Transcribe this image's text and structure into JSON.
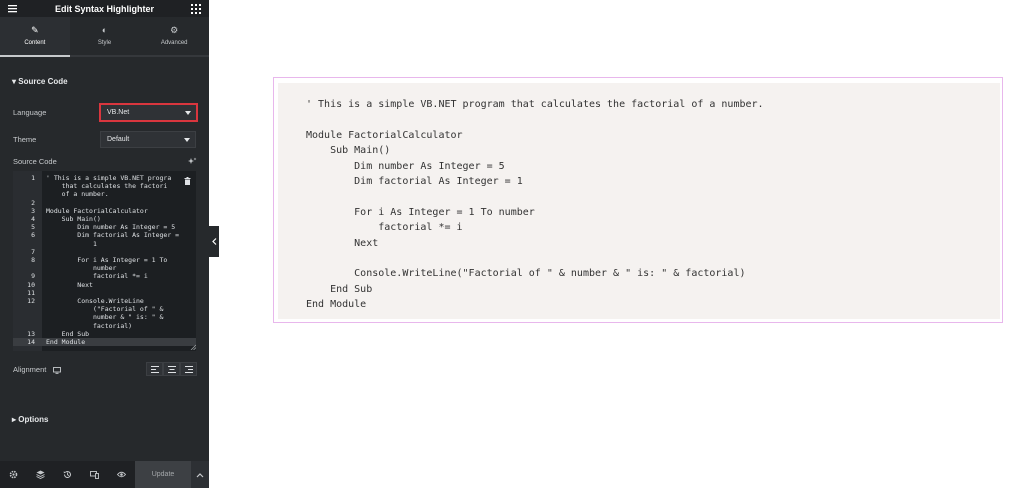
{
  "panel": {
    "title": "Edit Syntax Highlighter",
    "tabs": [
      {
        "label": "Content",
        "icon": "pencil-icon",
        "active": true
      },
      {
        "label": "Style",
        "icon": "half-circle-icon",
        "active": false
      },
      {
        "label": "Advanced",
        "icon": "gear-icon",
        "active": false
      }
    ],
    "section_title": "Source Code",
    "language": {
      "label": "Language",
      "value": "VB.Net"
    },
    "theme": {
      "label": "Theme",
      "value": "Default"
    },
    "source_code_label": "Source Code",
    "editor_rows": [
      {
        "num": "1",
        "text": "' This is a simple VB.NET progra"
      },
      {
        "num": "",
        "text": "    that calculates the factori"
      },
      {
        "num": "",
        "text": "    of a number."
      },
      {
        "num": "2",
        "text": ""
      },
      {
        "num": "3",
        "text": "Module FactorialCalculator"
      },
      {
        "num": "4",
        "text": "    Sub Main()"
      },
      {
        "num": "5",
        "text": "        Dim number As Integer = 5"
      },
      {
        "num": "6",
        "text": "        Dim factorial As Integer ="
      },
      {
        "num": "",
        "text": "            1"
      },
      {
        "num": "7",
        "text": ""
      },
      {
        "num": "8",
        "text": "        For i As Integer = 1 To"
      },
      {
        "num": "",
        "text": "            number"
      },
      {
        "num": "9",
        "text": "            factorial *= i"
      },
      {
        "num": "10",
        "text": "        Next"
      },
      {
        "num": "11",
        "text": ""
      },
      {
        "num": "12",
        "text": "        Console.WriteLine"
      },
      {
        "num": "",
        "text": "            (\"Factorial of \" &"
      },
      {
        "num": "",
        "text": "            number & \" is: \" &"
      },
      {
        "num": "",
        "text": "            factorial)"
      },
      {
        "num": "13",
        "text": "    End Sub"
      },
      {
        "num": "14",
        "text": "End Module"
      }
    ],
    "alignment_label": "Alignment",
    "options_title": "Options",
    "update_label": "Update"
  },
  "preview": {
    "code": "' This is a simple VB.NET program that calculates the factorial of a number.\n\nModule FactorialCalculator\n    Sub Main()\n        Dim number As Integer = 5\n        Dim factorial As Integer = 1\n\n        For i As Integer = 1 To number\n            factorial *= i\n        Next\n\n        Console.WriteLine(\"Factorial of \" & number & \" is: \" & factorial)\n    End Sub\nEnd Module"
  },
  "colors": {
    "panel_bg": "#26292c",
    "highlight_border": "#d9363e",
    "preview_border": "#e8b7ec",
    "preview_bg": "#f5f2f0"
  }
}
